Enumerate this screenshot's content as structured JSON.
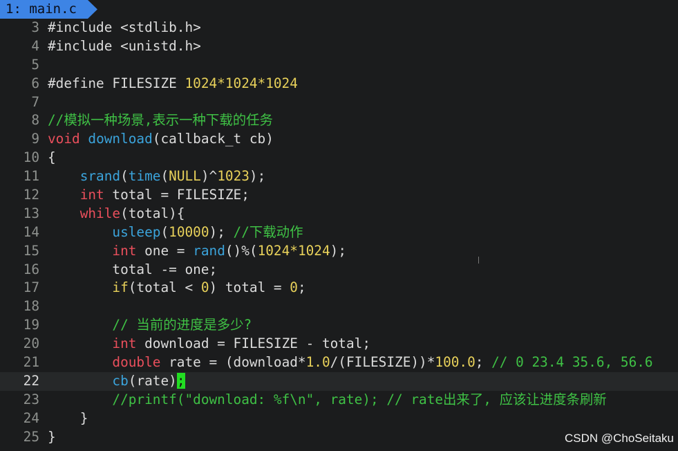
{
  "tab": {
    "label": "1: main.c"
  },
  "colors": {
    "background": "#1b1c1d",
    "tab": "#3d84e5",
    "keyword": "#ea4f5c",
    "function": "#3ba4dc",
    "number": "#e8d15a",
    "comment": "#3fc145",
    "cursor": "#22dd22"
  },
  "editor": {
    "current_line": "22",
    "lines": [
      {
        "num": "3",
        "segs": [
          {
            "t": "#include <stdlib.h>",
            "c": "#dcdcdc"
          }
        ]
      },
      {
        "num": "4",
        "segs": [
          {
            "t": "#include <unistd.h>",
            "c": "#dcdcdc"
          }
        ]
      },
      {
        "num": "5",
        "segs": []
      },
      {
        "num": "6",
        "segs": [
          {
            "t": "#define FILESIZE ",
            "c": "#dcdcdc"
          },
          {
            "t": "1024*1024*1024",
            "c": "#e8d15a"
          }
        ]
      },
      {
        "num": "7",
        "segs": []
      },
      {
        "num": "8",
        "segs": [
          {
            "t": "//模拟一种场景,表示一种下载的任务",
            "c": "#3fc145"
          }
        ]
      },
      {
        "num": "9",
        "segs": [
          {
            "t": "void",
            "c": "#ea4f5c"
          },
          {
            "t": " ",
            "c": "#dcdcdc"
          },
          {
            "t": "download",
            "c": "#3ba4dc"
          },
          {
            "t": "(callback_t cb)",
            "c": "#dcdcdc"
          }
        ]
      },
      {
        "num": "10",
        "segs": [
          {
            "t": "{",
            "c": "#dcdcdc"
          }
        ]
      },
      {
        "num": "11",
        "segs": [
          {
            "t": "    ",
            "c": "#dcdcdc"
          },
          {
            "t": "srand",
            "c": "#3ba4dc"
          },
          {
            "t": "(",
            "c": "#dcdcdc"
          },
          {
            "t": "time",
            "c": "#3ba4dc"
          },
          {
            "t": "(",
            "c": "#dcdcdc"
          },
          {
            "t": "NULL",
            "c": "#e8d15a"
          },
          {
            "t": ")^",
            "c": "#dcdcdc"
          },
          {
            "t": "1023",
            "c": "#e8d15a"
          },
          {
            "t": ");",
            "c": "#dcdcdc"
          }
        ]
      },
      {
        "num": "12",
        "segs": [
          {
            "t": "    ",
            "c": "#dcdcdc"
          },
          {
            "t": "int",
            "c": "#ea4f5c"
          },
          {
            "t": " total = FILESIZE;",
            "c": "#dcdcdc"
          }
        ]
      },
      {
        "num": "13",
        "segs": [
          {
            "t": "    ",
            "c": "#dcdcdc"
          },
          {
            "t": "while",
            "c": "#ea4f5c"
          },
          {
            "t": "(total){",
            "c": "#dcdcdc"
          }
        ]
      },
      {
        "num": "14",
        "segs": [
          {
            "t": "        ",
            "c": "#dcdcdc"
          },
          {
            "t": "usleep",
            "c": "#3ba4dc"
          },
          {
            "t": "(",
            "c": "#dcdcdc"
          },
          {
            "t": "10000",
            "c": "#e8d15a"
          },
          {
            "t": "); ",
            "c": "#dcdcdc"
          },
          {
            "t": "//下载动作",
            "c": "#3fc145"
          }
        ]
      },
      {
        "num": "15",
        "segs": [
          {
            "t": "        ",
            "c": "#dcdcdc"
          },
          {
            "t": "int",
            "c": "#ea4f5c"
          },
          {
            "t": " one = ",
            "c": "#dcdcdc"
          },
          {
            "t": "rand",
            "c": "#3ba4dc"
          },
          {
            "t": "()%(",
            "c": "#dcdcdc"
          },
          {
            "t": "1024*1024",
            "c": "#e8d15a"
          },
          {
            "t": ");",
            "c": "#dcdcdc"
          }
        ]
      },
      {
        "num": "16",
        "segs": [
          {
            "t": "        total -= one;",
            "c": "#dcdcdc"
          }
        ]
      },
      {
        "num": "17",
        "segs": [
          {
            "t": "        ",
            "c": "#dcdcdc"
          },
          {
            "t": "if",
            "c": "#e8d15a"
          },
          {
            "t": "(total < ",
            "c": "#dcdcdc"
          },
          {
            "t": "0",
            "c": "#e8d15a"
          },
          {
            "t": ") total = ",
            "c": "#dcdcdc"
          },
          {
            "t": "0",
            "c": "#e8d15a"
          },
          {
            "t": ";",
            "c": "#dcdcdc"
          }
        ]
      },
      {
        "num": "18",
        "segs": []
      },
      {
        "num": "19",
        "segs": [
          {
            "t": "        ",
            "c": "#dcdcdc"
          },
          {
            "t": "// 当前的进度是多少?",
            "c": "#3fc145"
          }
        ]
      },
      {
        "num": "20",
        "segs": [
          {
            "t": "        ",
            "c": "#dcdcdc"
          },
          {
            "t": "int",
            "c": "#ea4f5c"
          },
          {
            "t": " download = FILESIZE - total;",
            "c": "#dcdcdc"
          }
        ]
      },
      {
        "num": "21",
        "segs": [
          {
            "t": "        ",
            "c": "#dcdcdc"
          },
          {
            "t": "double",
            "c": "#ea4f5c"
          },
          {
            "t": " rate = (download*",
            "c": "#dcdcdc"
          },
          {
            "t": "1.0",
            "c": "#e8d15a"
          },
          {
            "t": "/(FILESIZE))*",
            "c": "#dcdcdc"
          },
          {
            "t": "100.0",
            "c": "#e8d15a"
          },
          {
            "t": "; ",
            "c": "#dcdcdc"
          },
          {
            "t": "// 0 23.4 35.6, 56.6",
            "c": "#3fc145"
          }
        ]
      },
      {
        "num": "22",
        "segs": [
          {
            "t": "        ",
            "c": "#dcdcdc"
          },
          {
            "t": "cb",
            "c": "#3ba4dc"
          },
          {
            "t": "(rate)",
            "c": "#dcdcdc"
          },
          {
            "t": ";",
            "c": "#101010",
            "cursor": true
          }
        ]
      },
      {
        "num": "23",
        "segs": [
          {
            "t": "        ",
            "c": "#dcdcdc"
          },
          {
            "t": "//printf(\"download: %f\\n\", rate); // rate出来了, 应该让进度条刷新",
            "c": "#3fc145"
          }
        ]
      },
      {
        "num": "24",
        "segs": [
          {
            "t": "    }",
            "c": "#dcdcdc"
          }
        ]
      },
      {
        "num": "25",
        "segs": [
          {
            "t": "}",
            "c": "#dcdcdc"
          }
        ]
      }
    ]
  },
  "watermark": "CSDN @ChoSeitaku"
}
